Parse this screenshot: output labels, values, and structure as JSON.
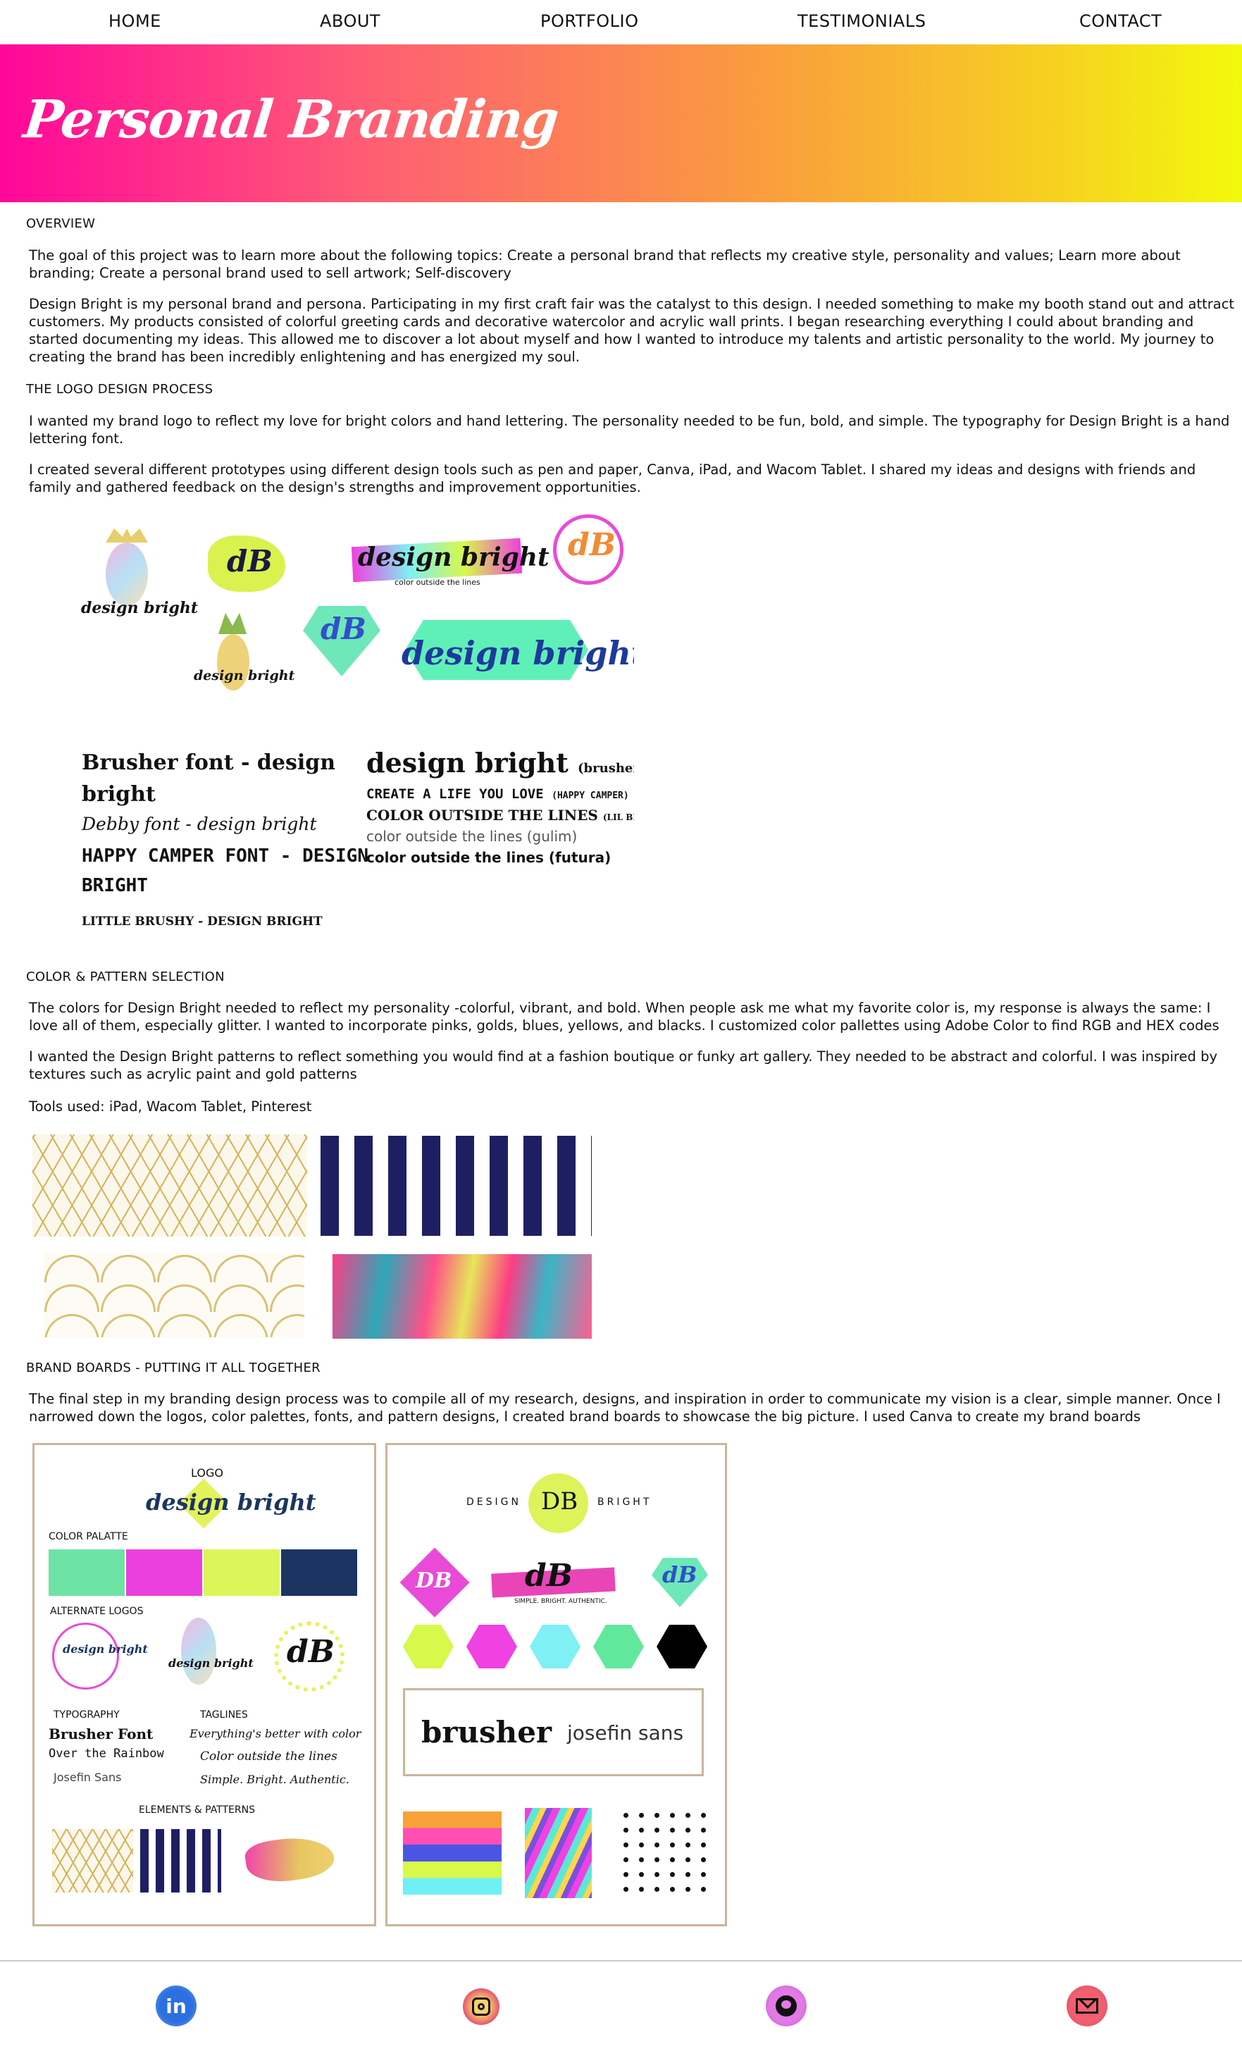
{
  "nav": {
    "items": [
      "HOME",
      "ABOUT",
      "PORTFOLIO",
      "TESTIMONIALS",
      "CONTACT"
    ]
  },
  "hero": {
    "title": "Personal Branding"
  },
  "sections": {
    "overview": {
      "heading": "OVERVIEW",
      "p1": "The goal of this project was to learn more about the following topics: Create a personal brand that reflects my creative style, personality and values; Learn more about branding; Create a personal brand used to sell artwork; Self-discovery",
      "p2": "Design Bright is my personal brand and persona. Participating in my first craft fair was the catalyst to this design. I needed something to make my booth stand out and attract customers. My products consisted of colorful greeting cards and decorative watercolor and acrylic wall prints. I began researching everything I could about branding and started documenting my ideas. This allowed me to discover a lot about myself and how I wanted to introduce my talents and artistic personality to the world. My journey to creating the brand has been incredibly enlightening and has energized my soul."
    },
    "logo": {
      "heading": "THE LOGO DESIGN PROCESS",
      "p1": "I wanted my brand logo to reflect my love for bright colors and hand lettering. The personality needed to be fun, bold, and simple. The typography for Design Bright is a hand lettering font.",
      "p2": "I created several different prototypes using different design tools such as pen and paper, Canva, iPad, and Wacom Tablet. I shared my ideas and designs with friends and family and gathered feedback on the design's strengths and improvement opportunities."
    },
    "color": {
      "heading": "COLOR & PATTERN SELECTION",
      "p1": "The colors for Design Bright needed to reflect my personality -colorful, vibrant, and bold. When people ask me what my favorite color is, my response is always the same: I love all of them, especially glitter. I wanted to incorporate pinks, golds, blues, yellows, and blacks. I customized color pallettes using Adobe Color to find RGB and HEX codes",
      "p2": "I wanted the Design Bright patterns to reflect something you would find at a fashion boutique or funky art gallery. They needed to be abstract and colorful. I was inspired by textures such as acrylic paint and gold patterns",
      "p3": "Tools used: iPad, Wacom Tablet, Pinterest"
    },
    "boards": {
      "heading": "BRAND BOARDS - PUTTING IT ALL TOGETHER",
      "p1": "The final step in my branding design process was to compile all of my research, designs, and inspiration in order to communicate my vision is a clear, simple manner. Once I narrowed down the logos, color palettes, fonts, and pattern designs, I created brand boards to showcase the big picture. I used Canva to create my brand boards"
    }
  },
  "logo_sheet": {
    "db": "dB",
    "design_bright": "design bright",
    "tagline": "color outside the lines",
    "font_samples": {
      "brusher": "Brusher font - design",
      "brusher2": "bright",
      "debby": "Debby font - design bright",
      "happy": "HAPPY CAMPER FONT - DESIGN",
      "happy2": "BRIGHT",
      "little": "LITTLE BRUSHY - DESIGN BRIGHT",
      "db_brusher": "design bright",
      "brusher_note": "(brusher)",
      "create": "CREATE A LIFE YOU LOVE",
      "create_note": "(HAPPY CAMPER)",
      "col": "COLOR OUTSIDE THE LINES",
      "col_note": "(LIL BRUSHY)",
      "gulim": "color outside the lines (gulim)",
      "futura": "color outside the lines (futura)"
    }
  },
  "board1": {
    "logo": "LOGO",
    "logo_text": "design bright",
    "palette": "COLOR PALATTE",
    "palette_colors": [
      "#6ee3a6",
      "#ec3fdf",
      "#dcf55a",
      "#1c3461"
    ],
    "alt": "ALTERNATE LOGOS",
    "alt_text": "design bright",
    "db": "dB",
    "typo": "TYPOGRAPHY",
    "typo_items": [
      "Brusher Font",
      "Over the Rainbow",
      "Josefin Sans"
    ],
    "taglines": "TAGLINES",
    "tagline_items": [
      "Everything's better with color",
      "Color outside the lines",
      "Simple. Bright. Authentic."
    ],
    "elements": "ELEMENTS & PATTERNS"
  },
  "board2": {
    "design": "DESIGN",
    "db": "DB",
    "bright": "BRIGHT",
    "tag": "SIMPLE. BRIGHT. AUTHENTIC.",
    "hex_colors": [
      "#d8f84a",
      "#f041e2",
      "#7ff0f4",
      "#62e89c",
      "#000000"
    ],
    "font1": "brusher",
    "font2": "josefin sans"
  },
  "footer": {
    "icons": [
      "linkedin-icon",
      "instagram-icon",
      "github-icon",
      "mail-icon"
    ],
    "in": "in"
  }
}
